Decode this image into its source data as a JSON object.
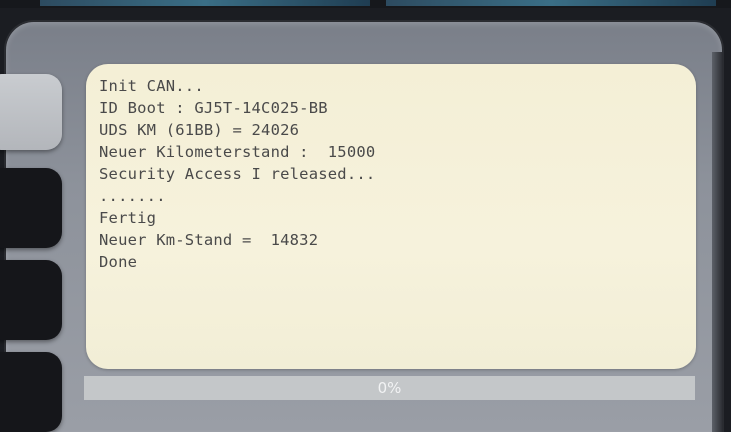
{
  "console": {
    "lines": [
      "Init CAN...",
      "ID Boot : GJ5T-14C025-BB",
      "UDS KM (61BB) = 24026",
      "Neuer Kilometerstand :  15000",
      "Security Access I released...",
      ".......",
      "Fertig",
      "Neuer Km-Stand =  14832",
      "Done"
    ]
  },
  "progress": {
    "value": 0,
    "label": "0%"
  },
  "side_menu": {
    "items": [
      {
        "state": "active"
      },
      {
        "state": "inactive"
      },
      {
        "state": "inactive"
      },
      {
        "state": "inactive"
      }
    ]
  },
  "colors": {
    "console_background": "#f4efd6",
    "console_text": "#4a4a4a",
    "screen_frame": "#8d929b",
    "side_button": "#15161a",
    "side_button_active": "#c9ccd0",
    "progress_track": "#c4c7c9",
    "progress_label": "#f2f3f4"
  }
}
